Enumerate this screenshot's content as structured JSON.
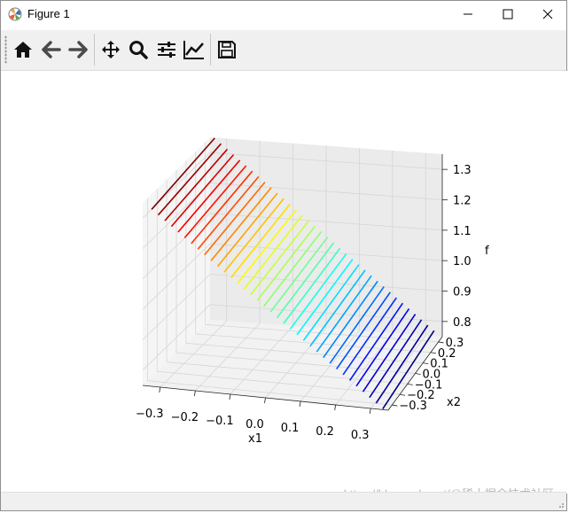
{
  "window": {
    "title": "Figure 1",
    "controls": {
      "minimize": "minimize",
      "maximize": "maximize",
      "close": "close"
    }
  },
  "toolbar": {
    "buttons": [
      {
        "name": "home",
        "icon": "home-icon"
      },
      {
        "name": "back",
        "icon": "back-arrow-icon"
      },
      {
        "name": "forward",
        "icon": "forward-arrow-icon"
      },
      {
        "name": "pan",
        "icon": "move-icon"
      },
      {
        "name": "zoom",
        "icon": "zoom-icon"
      },
      {
        "name": "subplots",
        "icon": "sliders-icon"
      },
      {
        "name": "customize",
        "icon": "line-chart-icon"
      },
      {
        "name": "save",
        "icon": "save-icon"
      }
    ]
  },
  "watermark": "https://blog.csdn.net/@稀土掘金技术社区",
  "chart_data": {
    "type": "surface-wireframe-3d",
    "xlabel": "x1",
    "ylabel": "x2",
    "zlabel": "f",
    "x_ticks": [
      "−0.3",
      "−0.2",
      "−0.1",
      "0.0",
      "0.1",
      "0.2",
      "0.3"
    ],
    "y_ticks": [
      "0.3",
      "0.2",
      "0.1",
      "0.0",
      "−0.1",
      "−0.2",
      "−0.3"
    ],
    "z_ticks": [
      "0.8",
      "0.9",
      "1.0",
      "1.1",
      "1.2",
      "1.3"
    ],
    "xlim": [
      -0.35,
      0.35
    ],
    "ylim": [
      -0.35,
      0.35
    ],
    "zlim": [
      0.75,
      1.35
    ],
    "colormap": "jet",
    "n_lines": 36,
    "z_range": [
      0.76,
      1.34
    ]
  }
}
